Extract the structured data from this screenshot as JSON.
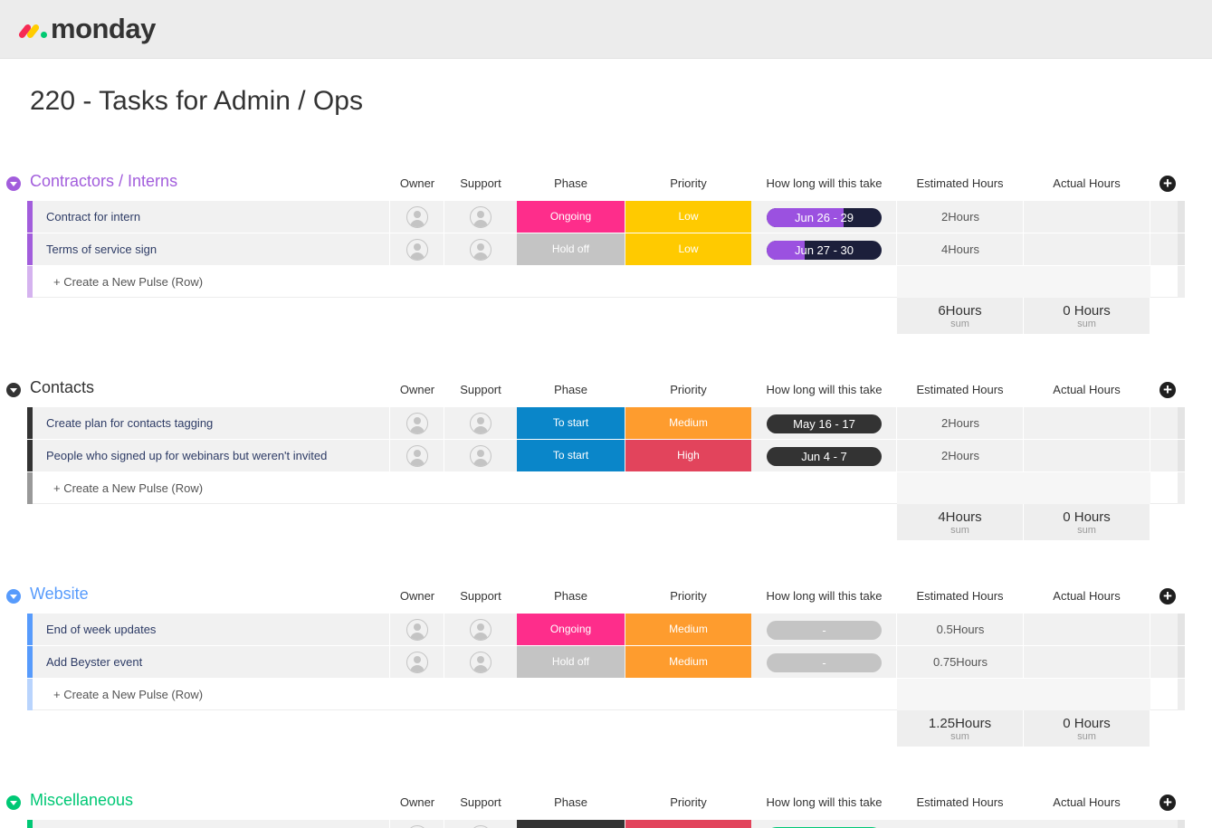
{
  "app": {
    "name": "monday"
  },
  "colors": {
    "ongoing": "#fe2d8b",
    "hold_off": "#c4c4c4",
    "to_start": "#0a86c9",
    "low": "#ffca00",
    "medium": "#fe9c2e",
    "high": "#e2445c",
    "timeline_dark": "#1c1f3b",
    "timeline_purple": "#9b51e0",
    "timeline_empty": "#c4c4c4"
  },
  "board": {
    "title": "220 - Tasks for Admin / Ops"
  },
  "columns": {
    "owner": "Owner",
    "support": "Support",
    "phase": "Phase",
    "priority": "Priority",
    "timeline": "How long will this take",
    "estimated": "Estimated Hours",
    "actual": "Actual Hours"
  },
  "new_row_label": "+ Create a New Pulse (Row)",
  "sum_label": "sum",
  "groups": [
    {
      "title": "Contractors / Interns",
      "color": "#a25ddc",
      "rows": [
        {
          "name": "Contract for intern",
          "phase": "Ongoing",
          "priority": "Low",
          "timeline": "Jun 26 - 29",
          "timeline_progress": 0.67,
          "estimated": "2Hours",
          "actual": ""
        },
        {
          "name": "Terms of service sign",
          "phase": "Hold off",
          "priority": "Low",
          "timeline": "Jun 27 - 30",
          "timeline_progress": 0.33,
          "estimated": "4Hours",
          "actual": ""
        }
      ],
      "sum_estimated": "6Hours",
      "sum_actual": "0 Hours"
    },
    {
      "title": "Contacts",
      "color": "#333333",
      "rows": [
        {
          "name": "Create plan for contacts tagging",
          "phase": "To start",
          "priority": "Medium",
          "timeline": "May 16 - 17",
          "timeline_progress": 0,
          "estimated": "2Hours",
          "actual": ""
        },
        {
          "name": "People who signed up for webinars but weren't invited",
          "phase": "To start",
          "priority": "High",
          "timeline": "Jun 4 - 7",
          "timeline_progress": 0,
          "estimated": "2Hours",
          "actual": ""
        }
      ],
      "sum_estimated": "4Hours",
      "sum_actual": "0 Hours"
    },
    {
      "title": "Website",
      "color": "#579bfc",
      "rows": [
        {
          "name": "End of week updates",
          "phase": "Ongoing",
          "priority": "Medium",
          "timeline": "-",
          "timeline_progress": 0,
          "estimated": "0.5Hours",
          "actual": ""
        },
        {
          "name": "Add Beyster event",
          "phase": "Hold off",
          "priority": "Medium",
          "timeline": "-",
          "timeline_progress": 0,
          "estimated": "0.75Hours",
          "actual": ""
        }
      ],
      "sum_estimated": "1.25Hours",
      "sum_actual": "0 Hours"
    },
    {
      "title": "Miscellaneous",
      "color": "#00c875"
    }
  ]
}
